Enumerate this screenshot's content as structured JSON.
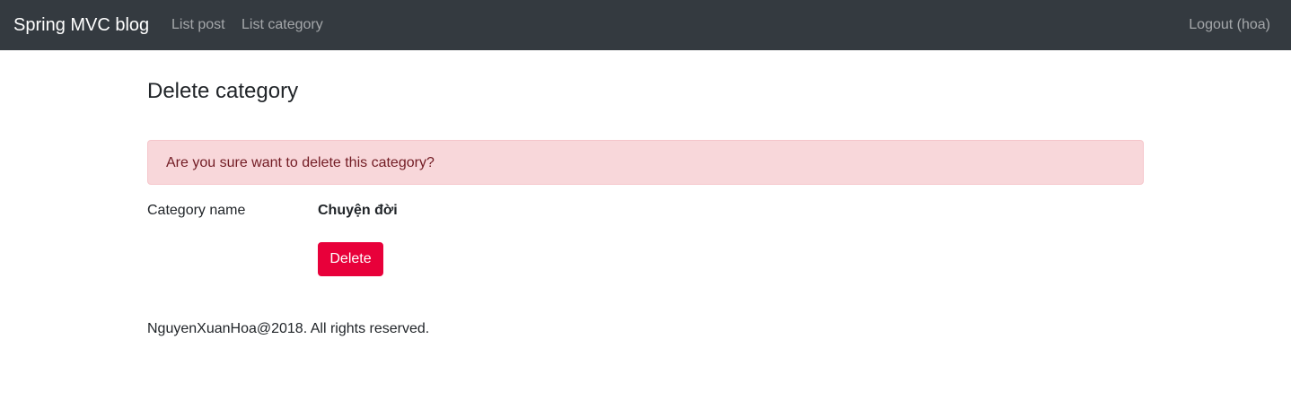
{
  "navbar": {
    "brand": "Spring MVC blog",
    "links": [
      {
        "label": "List post"
      },
      {
        "label": "List category"
      }
    ],
    "logout_label": "Logout (hoa)",
    "background_color": "#343a40"
  },
  "page": {
    "title": "Delete category"
  },
  "alert": {
    "message": "Are you sure want to delete this category?",
    "background_color": "#f8d7da",
    "text_color": "#721c24"
  },
  "form": {
    "field_label": "Category name",
    "field_value": "Chuyện đời",
    "delete_label": "Delete",
    "delete_color": "#e8003a"
  },
  "footer": {
    "text": "NguyenXuanHoa@2018. All rights reserved."
  }
}
